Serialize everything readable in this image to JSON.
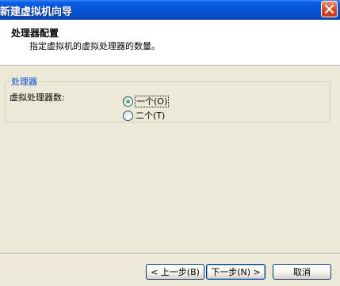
{
  "window": {
    "title": "新建虚拟机向导",
    "close_icon": "close-icon"
  },
  "header": {
    "title": "处理器配置",
    "subtitle": "指定虚拟机的虚拟处理器的数量。"
  },
  "group": {
    "legend": "处理器",
    "label": "虚拟处理器数:",
    "options": [
      {
        "label": "一个(O)",
        "checked": true
      },
      {
        "label": "二个(T)",
        "checked": false
      }
    ]
  },
  "buttons": {
    "back": "< 上一步(B)",
    "next": "下一步(N) >",
    "cancel": "取消"
  },
  "colors": {
    "titlebar": "#0653d6",
    "face": "#ece9d8",
    "group_legend": "#0046d5",
    "radio_dot": "#21a121"
  }
}
